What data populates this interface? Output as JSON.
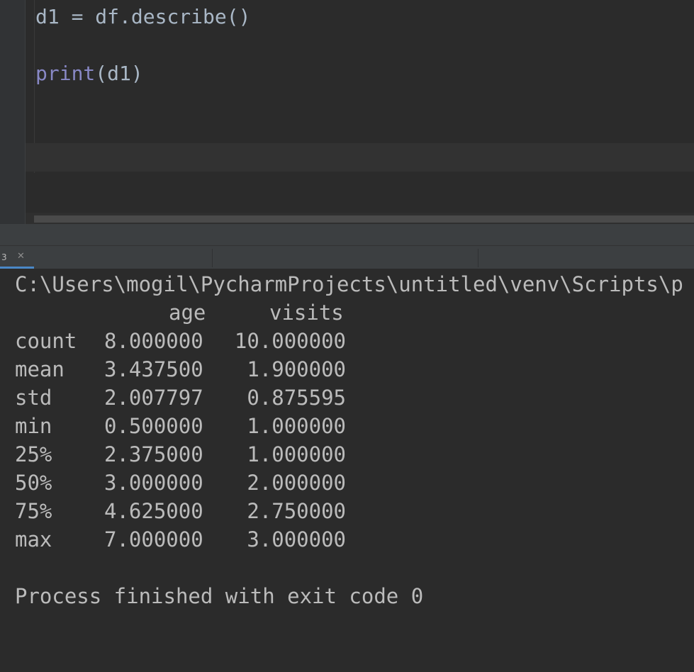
{
  "editor": {
    "line1": {
      "var": "d1",
      "op": "=",
      "expr": "df.describe()"
    },
    "line3": {
      "func": "print",
      "arg": "(d1)"
    }
  },
  "run_tab": {
    "label": "3",
    "close_icon": "close-icon"
  },
  "console": {
    "command": "C:\\Users\\mogil\\PycharmProjects\\untitled\\venv\\Scripts\\p",
    "columns": [
      "age",
      "visits"
    ],
    "rows": [
      {
        "label": "count",
        "age": "8.000000",
        "visits": "10.000000"
      },
      {
        "label": "mean",
        "age": "3.437500",
        "visits": "1.900000"
      },
      {
        "label": "std",
        "age": "2.007797",
        "visits": "0.875595"
      },
      {
        "label": "min",
        "age": "0.500000",
        "visits": "1.000000"
      },
      {
        "label": "25%",
        "age": "2.375000",
        "visits": "1.000000"
      },
      {
        "label": "50%",
        "age": "3.000000",
        "visits": "2.000000"
      },
      {
        "label": "75%",
        "age": "4.625000",
        "visits": "2.750000"
      },
      {
        "label": "max",
        "age": "7.000000",
        "visits": "3.000000"
      }
    ],
    "exit_message": "Process finished with exit code 0"
  },
  "colors": {
    "background": "#2b2b2b",
    "text": "#bbbbbb",
    "code_text": "#a9b7c6",
    "builtin": "#8888c6",
    "tab_accent": "#4a88c7"
  }
}
